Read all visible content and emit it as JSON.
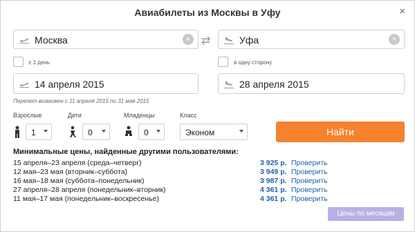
{
  "dialog": {
    "title": "Авиабилеты из Москвы в Уфу",
    "close": "×"
  },
  "from": {
    "value": "Москва",
    "clear": "×",
    "icon": "plane-takeoff-icon"
  },
  "to": {
    "value": "Уфа",
    "clear": "×",
    "icon": "plane-landing-icon"
  },
  "swap": {
    "icon": "swap-arrows-icon",
    "glyph": "⇄"
  },
  "options": {
    "flex_days": "± 1 день",
    "one_way": "в одну сторону"
  },
  "dates": {
    "depart": "14 апреля 2015",
    "return": "28 апреля 2015",
    "note": "Перелет возможен с 11 апреля 2015 по 31 мая 2015"
  },
  "passengers": {
    "adults_label": "Взрослые",
    "adults_value": "1",
    "children_label": "Дети",
    "children_value": "0",
    "infants_label": "Младенцы",
    "infants_value": "0",
    "class_label": "Класс",
    "class_value": "Эконом"
  },
  "search_button": "Найти",
  "min_prices": {
    "heading": "Минимальные цены, найденные другими пользователями:",
    "rows": [
      {
        "dates": "15 апреля–23 апреля (среда–четверг)",
        "price": "3 925 р.",
        "action": "Проверить"
      },
      {
        "dates": "12 мая–23 мая (вторник–суббота)",
        "price": "3 949 р.",
        "action": "Проверить"
      },
      {
        "dates": "16 мая–18 мая (суббота–понедельник)",
        "price": "3 987 р.",
        "action": "Проверить"
      },
      {
        "dates": "27 апреля–28 апреля (понедельник–вторник)",
        "price": "4 361 р.",
        "action": "Проверить"
      },
      {
        "dates": "11 мая–17 мая (понедельник–воскресенье)",
        "price": "4 361 р.",
        "action": "Проверить"
      }
    ]
  },
  "months_button": "Цены по месяцам",
  "colors": {
    "accent": "#f7822d",
    "link": "#1f5fa8",
    "months_button": "#b8b0e6"
  }
}
